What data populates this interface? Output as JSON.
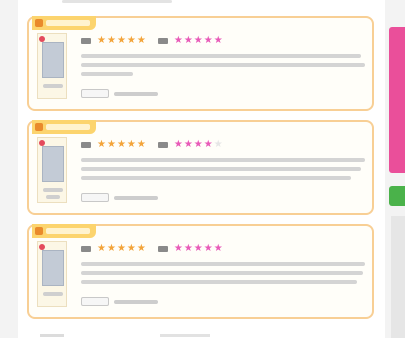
{
  "page": {
    "title": "",
    "bg_color": "#f3f3f3"
  },
  "reviews": [
    {
      "badge": "",
      "badge_color": "#fcd46e",
      "photo_caption": "",
      "rating_label_a": "",
      "stars_a": 5,
      "rating_label_b": "",
      "stars_b": 5,
      "body": "",
      "button_label": "",
      "meta": ""
    },
    {
      "badge": "",
      "badge_color": "#fcd46e",
      "photo_caption": "",
      "rating_label_a": "",
      "stars_a": 5,
      "rating_label_b": "",
      "stars_b": 4,
      "body": "",
      "button_label": "",
      "meta": ""
    },
    {
      "badge": "",
      "badge_color": "#fcd46e",
      "photo_caption": "",
      "rating_label_a": "",
      "stars_a": 5,
      "rating_label_b": "",
      "stars_b": 5,
      "body": "",
      "button_label": "",
      "meta": ""
    }
  ],
  "colors": {
    "card_border": "#f8cf95",
    "star_a": "#f3a43a",
    "star_b": "#e85ab8",
    "side_tab_pink": "#ea4f9a",
    "side_tab_green": "#4ab24a"
  },
  "icons": {
    "badge": "crown-icon",
    "star": "star-icon",
    "photo_mark": "heart-icon"
  }
}
